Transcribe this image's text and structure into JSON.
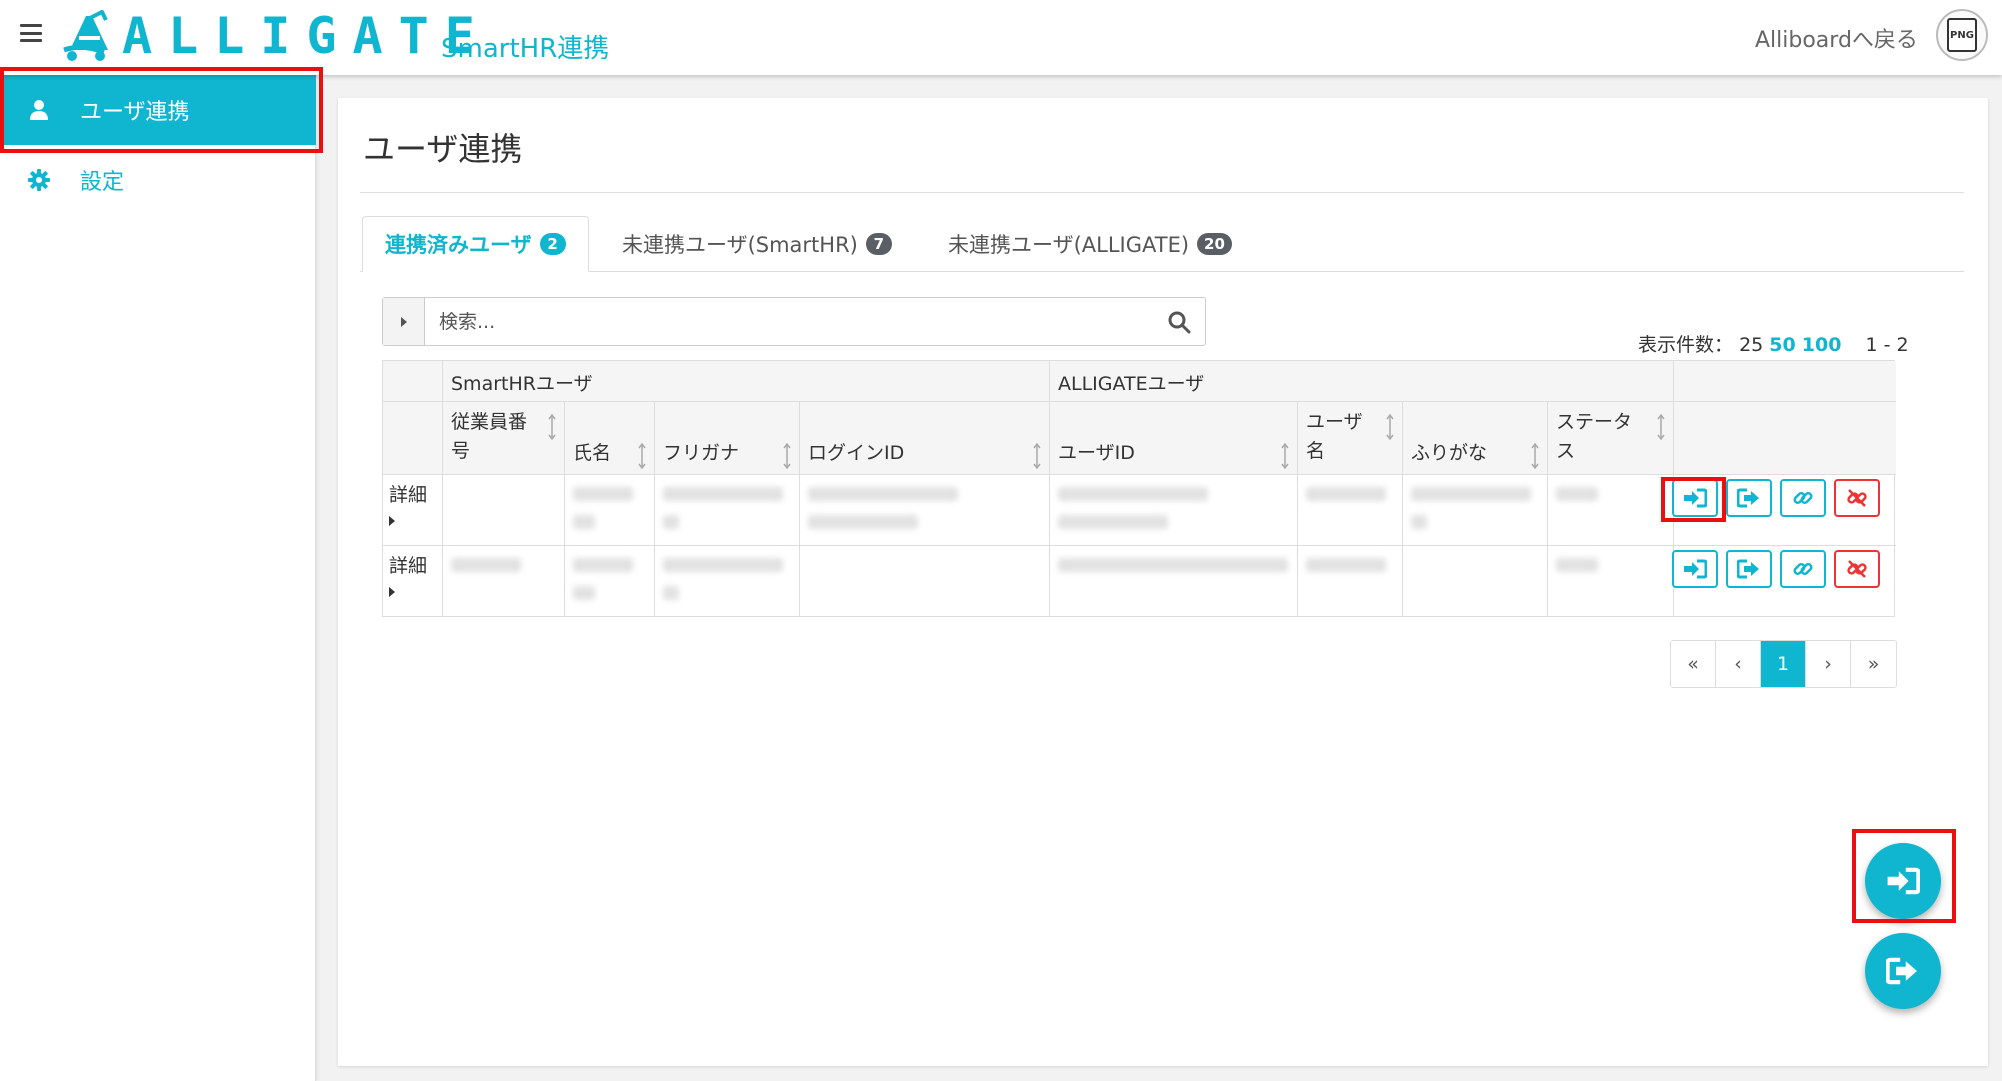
{
  "header": {
    "logo_text": "ALLIGATE",
    "app_subtitle": "SmartHR連携",
    "back_link": "Alliboardへ戻る",
    "avatar_label": "PNG"
  },
  "sidebar": {
    "items": [
      {
        "label": "ユーザ連携",
        "icon": "user-icon",
        "active": true
      },
      {
        "label": "設定",
        "icon": "gear-icon",
        "active": false
      }
    ]
  },
  "main": {
    "title": "ユーザ連携",
    "tabs": [
      {
        "label": "連携済みユーザ",
        "count": "2"
      },
      {
        "label": "未連携ユーザ(SmartHR)",
        "count": "7"
      },
      {
        "label": "未連携ユーザ(ALLIGATE)",
        "count": "20"
      }
    ],
    "search": {
      "placeholder": "検索..."
    },
    "page_size": {
      "label": "表示件数：",
      "options": [
        "25",
        "50",
        "100"
      ],
      "selected": [
        "50",
        "100"
      ],
      "range": "1 - 2"
    },
    "table": {
      "groups": [
        "SmartHRユーザ",
        "ALLIGATEユーザ"
      ],
      "columns": [
        "従業員番号",
        "氏名",
        "フリガナ",
        "ログインID",
        "ユーザID",
        "ユーザ名",
        "ふりがな",
        "ステータス"
      ],
      "col_display": [
        "従業員番\n号",
        "氏名",
        "フリガナ",
        "ログインID",
        "ユーザID",
        "ユーザ\n名",
        "ふりがな",
        "ステータ\nス"
      ],
      "rows": [
        {
          "detail": "詳細"
        },
        {
          "detail": "詳細"
        }
      ],
      "actions": [
        "link-in-icon",
        "sign-out-icon",
        "link-icon",
        "unlink-icon"
      ]
    },
    "pagination": {
      "first": "«",
      "prev": "‹",
      "current": "1",
      "next": "›",
      "last": "»"
    }
  },
  "fabs": [
    "sign-in-icon",
    "sign-out-icon"
  ],
  "colors": {
    "accent": "#10b5cf",
    "danger": "#e33333",
    "highlight_box": "#e81010",
    "badge": "#5a5f66"
  }
}
